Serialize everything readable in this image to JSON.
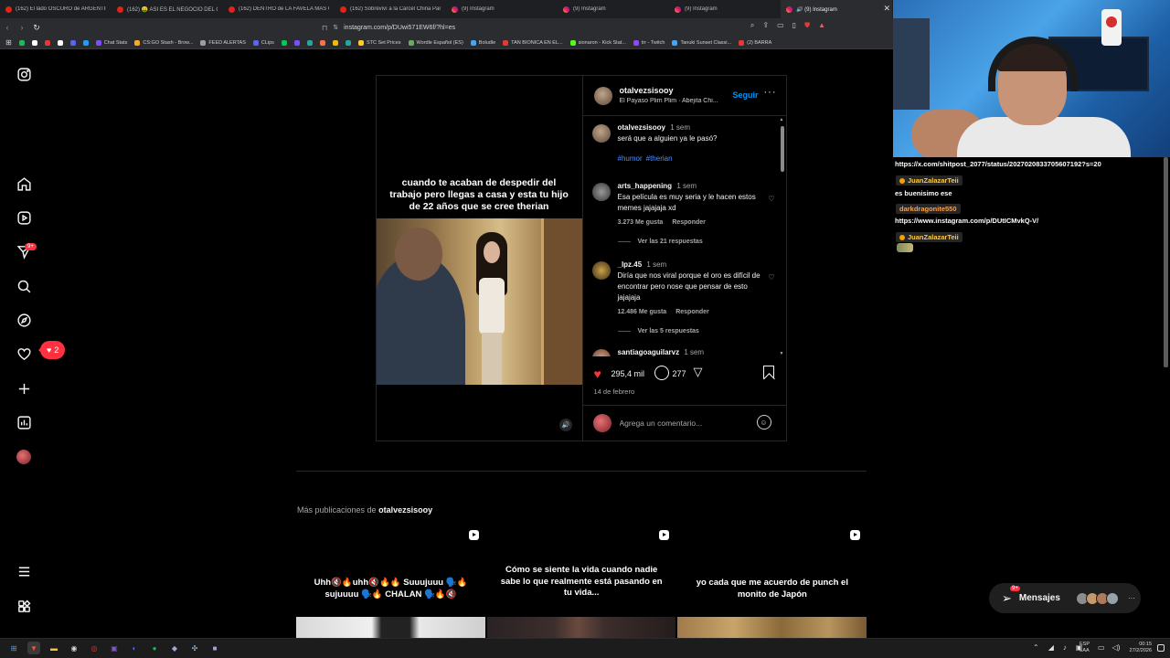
{
  "browser": {
    "tabs": [
      {
        "label": "(162) El lado OSCURO de ARGENTINA",
        "kind": "yt"
      },
      {
        "label": "(162) 🤑 ASI ES EL NEGOCIO DEL CARTEL",
        "kind": "yt"
      },
      {
        "label": "(162) DENTRO de LA FAVELA MÁS GRANDE",
        "kind": "yt"
      },
      {
        "label": "(162) Sobreviví a la Cárcel China Para",
        "kind": "yt"
      },
      {
        "label": "(9) Instagram",
        "kind": "ig"
      },
      {
        "label": "(9) Instagram",
        "kind": "ig"
      },
      {
        "label": "(9) Instagram",
        "kind": "ig"
      },
      {
        "label": "🔊 (9) Instagram",
        "kind": "ig",
        "active": true
      }
    ],
    "url": "instagram.com/p/DUwi571EW6f/?hl=es",
    "bookmarks": [
      {
        "label": "",
        "color": "#1db954"
      },
      {
        "label": "",
        "color": "#ffffff"
      },
      {
        "label": "",
        "color": "#e53935"
      },
      {
        "label": "",
        "color": "#ffffff"
      },
      {
        "label": "",
        "color": "#5865f2"
      },
      {
        "label": "",
        "color": "#1da1f2"
      },
      {
        "label": "Chat Stats",
        "color": "#7c4dff"
      },
      {
        "label": "CS:GO Stash - Brow...",
        "color": "#f9a825"
      },
      {
        "label": "FEED ALERTAS",
        "color": "#9e9e9e"
      },
      {
        "label": "CLips",
        "color": "#5865f2"
      },
      {
        "label": "",
        "color": "#00c853"
      },
      {
        "label": "",
        "color": "#7c4dff"
      },
      {
        "label": "",
        "color": "#26a69a"
      },
      {
        "label": "",
        "color": "#ff7043"
      },
      {
        "label": "",
        "color": "#f0b90b"
      },
      {
        "label": "",
        "color": "#26a69a"
      },
      {
        "label": "STC Set Prices",
        "color": "#ffca28"
      },
      {
        "label": "Wordle Español (ES)",
        "color": "#6aaa64"
      },
      {
        "label": "Boludle",
        "color": "#42a5f5"
      },
      {
        "label": "TAN BIONICA EN EL...",
        "color": "#e53935"
      },
      {
        "label": "sionaron - Kick Stat...",
        "color": "#53fc18"
      },
      {
        "label": "trr - Twitch",
        "color": "#9146ff"
      },
      {
        "label": "Tanuki Sunset Classi...",
        "color": "#42a5f5"
      },
      {
        "label": "(2) BARRA",
        "color": "#e53935"
      }
    ]
  },
  "sidebar": {
    "notif_badge": "9+",
    "notif_pill_count": "2"
  },
  "post": {
    "author": "otalvezsisooy",
    "audio": "El Payaso Plim Plim · Abejita Chi...",
    "follow_label": "Seguir",
    "more_label": "···",
    "media_caption": "cuando te acaban de despedir del trabajo pero llegas a casa y esta tu hijo de 22 años que se cree therian",
    "caption": {
      "user": "otalvezsisooy",
      "time": "1 sem",
      "text": "será que a alguien ya le pasó?",
      "tags": [
        "#humor",
        "#therian"
      ]
    },
    "comments": [
      {
        "user": "arts_happening",
        "time": "1 sem",
        "text": "Esa película es muy seria y le hacen estos memes jajajaja xd",
        "likes": "3.273 Me gusta",
        "reply": "Responder",
        "view_replies": "Ver las 21 respuestas"
      },
      {
        "user": "_lpz.45",
        "time": "1 sem",
        "text": "Diría que nos viral porque el oro es difícil de encontrar pero nose que pensar de esto jajajaja",
        "likes": "12.486 Me gusta",
        "reply": "Responder",
        "view_replies": "Ver las 5 respuestas"
      },
      {
        "user": "santiagoaguilarvz",
        "time": "1 sem",
        "text": ""
      }
    ],
    "likes": "295,4 mil",
    "comment_count": "277",
    "date": "14 de febrero",
    "comment_placeholder": "Agrega un comentario..."
  },
  "more_posts": {
    "prefix": "Más publicaciones de",
    "author": "otalvezsisooy",
    "items": [
      {
        "caption": "Uhh🔇🔥uhh🔇🔥🔥 Suuujuuu 🗣️🔥 sujuuuu 🗣️🔥 CHALAN 🗣️🔥🔇",
        "tone": "#2a2a2a"
      },
      {
        "caption": "Cómo se siente la vida cuando nadie sabe lo que realmente está pasando en tu vida...",
        "tone": "#3a2a24"
      },
      {
        "caption": "yo cada que me acuerdo de punch el monito de Japón",
        "tone": "#8a6a3a"
      }
    ]
  },
  "messages": {
    "label": "Mensajes",
    "badge": "9+"
  },
  "chat": {
    "line1": "https://x.com/shitpost_2077/status/2027020833705607192?s=20",
    "user1": "JuanZalazarTeii",
    "msg1": "es buenisimo ese",
    "user2": "darkdragonite550",
    "msg2": "https://www.instagram.com/p/DUtICMvkQ-V/",
    "user3": "JuanZalazarTeii"
  },
  "taskbar": {
    "lang_top": "ESP",
    "lang_bottom": "LAA",
    "time": "00:15",
    "date": "27/2/2026"
  },
  "colors": {
    "accent_blue": "#0095f6",
    "like_red": "#ff3040",
    "background": "#000000"
  }
}
